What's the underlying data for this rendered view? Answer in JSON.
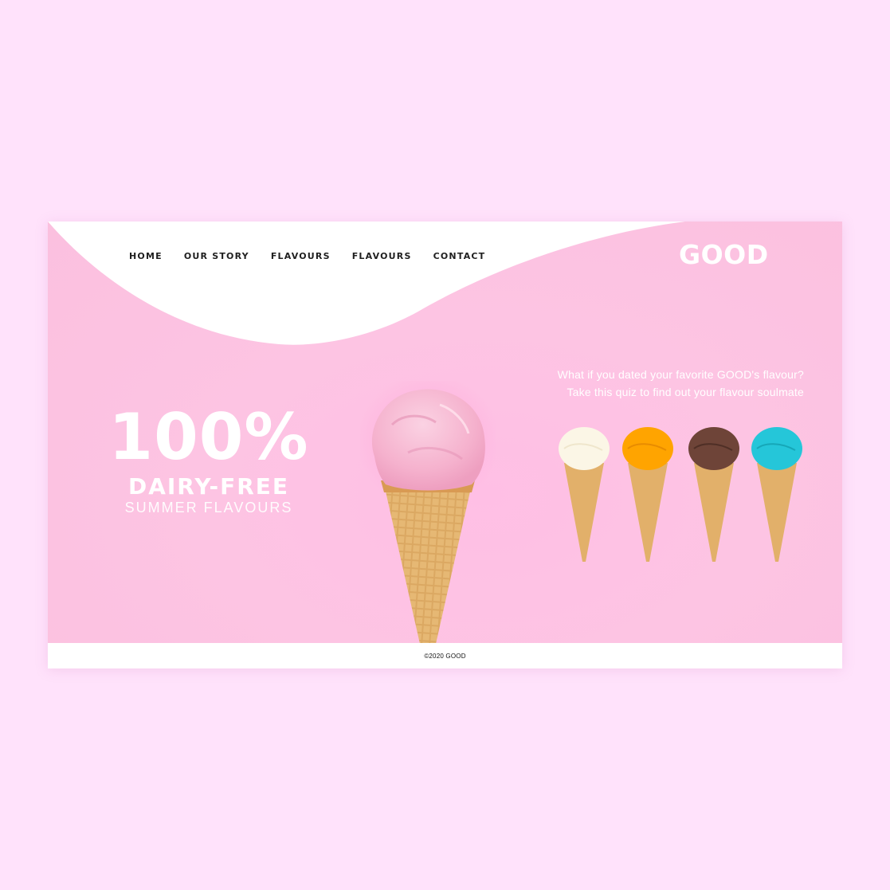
{
  "nav": {
    "items": [
      {
        "label": "HOME"
      },
      {
        "label": "OUR STORY"
      },
      {
        "label": "FLAVOURS"
      },
      {
        "label": "FLAVOURS"
      },
      {
        "label": "CONTACT"
      }
    ]
  },
  "brand": {
    "logo": "GOOD"
  },
  "hero": {
    "headline": "100%",
    "subheadline": "DAIRY-FREE",
    "tagline": "SUMMER FLAVOURS",
    "quiz_line1": "What if you dated your favorite GOOD's flavour?",
    "quiz_line2": "Take this quiz to find out your flavour soulmate"
  },
  "flavours": [
    {
      "name": "vanilla",
      "color": "#fbf6e6"
    },
    {
      "name": "mango",
      "color": "#ffa400"
    },
    {
      "name": "chocolate",
      "color": "#6e4438"
    },
    {
      "name": "blue-raspberry",
      "color": "#25c6d9"
    }
  ],
  "colors": {
    "page_bg": "#ffe2fb",
    "hero_pink": "#fdc4e3",
    "strawberry": "#f9b8d4",
    "cone": "#d9a45e"
  },
  "footer": {
    "copyright": "©2020 GOOD"
  }
}
